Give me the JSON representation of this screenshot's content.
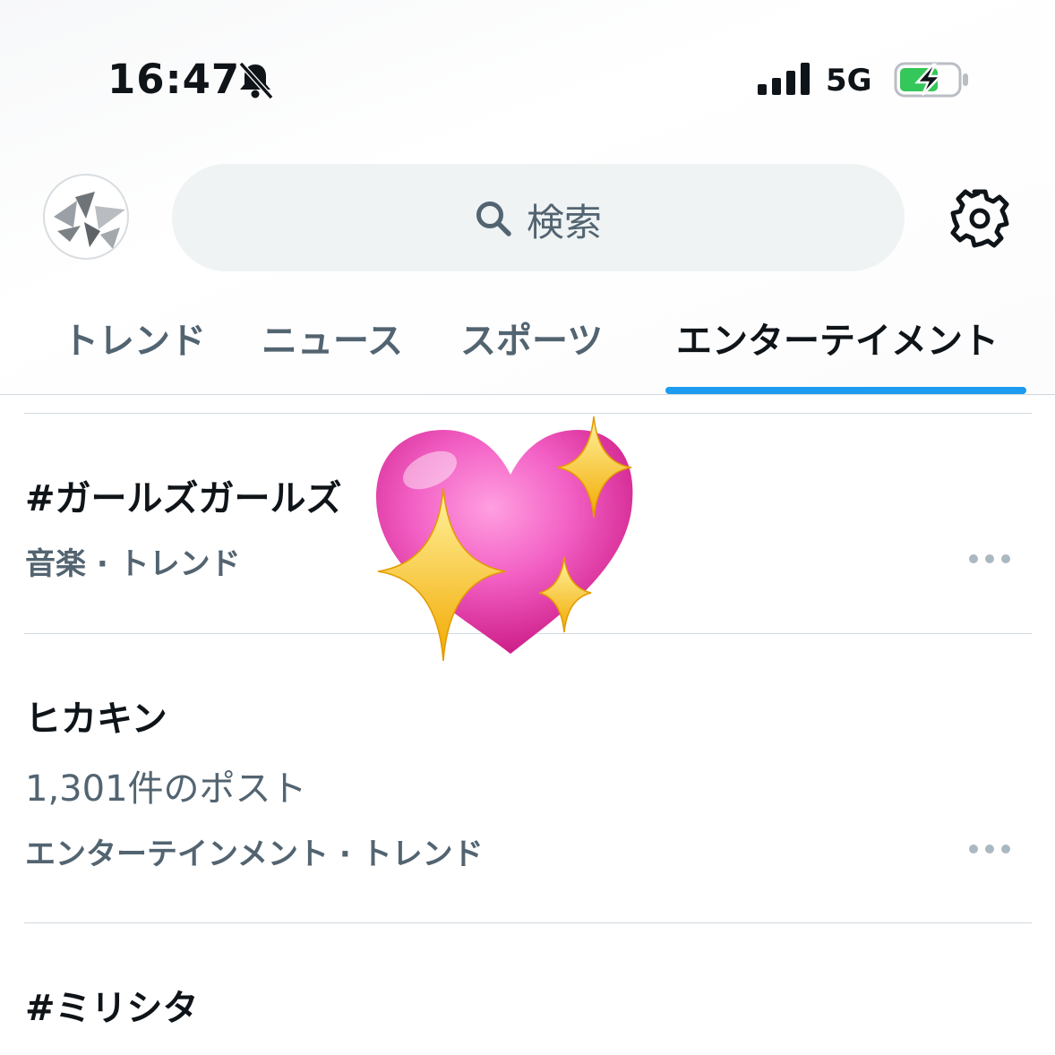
{
  "status_bar": {
    "time": "16:47",
    "network": "5G"
  },
  "header": {
    "search_placeholder": "検索"
  },
  "tabs": [
    {
      "label": "トレンド",
      "active": false
    },
    {
      "label": "ニュース",
      "active": false
    },
    {
      "label": "スポーツ",
      "active": false
    },
    {
      "label": "エンターテイメント",
      "active": true
    }
  ],
  "trends": [
    {
      "title": "#ガールズガールズ",
      "meta": "音楽 · トレンド"
    },
    {
      "title": "ヒカキン",
      "count": "1,301件のポスト",
      "meta": "エンターテインメント · トレンド"
    },
    {
      "title": "#ミリシタ"
    }
  ],
  "colors": {
    "accent": "#1d9bf0",
    "secondary_text": "#536471",
    "battery_green": "#34c759"
  },
  "icons": [
    "bell-slash-icon",
    "signal-icon",
    "battery-charging-icon",
    "search-icon",
    "gear-icon",
    "more-icon",
    "sparkling-heart-icon"
  ]
}
